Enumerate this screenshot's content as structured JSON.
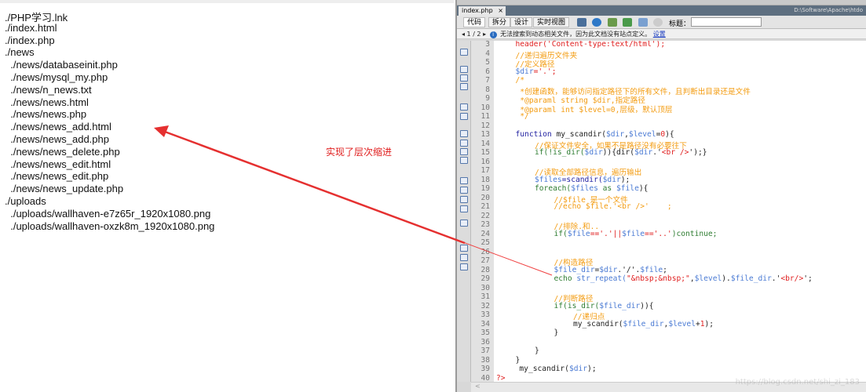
{
  "file_list": [
    "./PHP学习.lnk",
    "./index.html",
    "./index.php",
    "./news",
    "  ./news/databaseinit.php",
    "  ./news/mysql_my.php",
    "  ./news/n_news.txt",
    "  ./news/news.html",
    "  ./news/news.php",
    "  ./news/news_add.html",
    "  ./news/news_add.php",
    "  ./news/news_delete.php",
    "  ./news/news_edit.html",
    "  ./news/news_edit.php",
    "  ./news/news_update.php",
    "./uploads",
    "  ./uploads/wallhaven-e7z65r_1920x1080.png",
    "  ./uploads/wallhaven-oxzk8m_1920x1080.png"
  ],
  "annotation": "实现了层次缩进",
  "annotation_color": "#e02020",
  "ide": {
    "tab": "index.php",
    "tab_close": "×",
    "path": "D:\\Software\\Apache\\htdo",
    "view_buttons": [
      "代码",
      "拆分",
      "设计",
      "实时视图"
    ],
    "title_label": "标题：",
    "title_value": "",
    "info": {
      "nav": "◂ 1 / 2 ▸",
      "icon": "i",
      "text": "无法搜索到动态相关文件，因为此文档没有站点定义。",
      "link": "设置"
    },
    "scroll_left": "<",
    "watermark": "https://blog.csdn.net/shi_zi_183",
    "colors": {
      "c": "#f39c12",
      "v": "#4b7bd4",
      "k": "#1f1fa0",
      "g": "#2f7d32",
      "d": "#222",
      "r": "#e02020",
      "s": "#4b7bd4"
    },
    "lines": [
      {
        "n": 3,
        "i": 1,
        "t": [
          [
            "header('Content-type:text/html');",
            "r"
          ]
        ]
      },
      {
        "n": 4,
        "i": 1,
        "t": [
          [
            "//递归遍历文件夹",
            "c"
          ]
        ]
      },
      {
        "n": 5,
        "i": 1,
        "t": [
          [
            "//定义路径",
            "c"
          ]
        ]
      },
      {
        "n": 6,
        "i": 1,
        "t": [
          [
            "$dir",
            "v"
          ],
          [
            "='.';",
            "r"
          ]
        ]
      },
      {
        "n": 7,
        "i": 1,
        "t": [
          [
            "/*",
            "c"
          ]
        ]
      },
      {
        "n": 8,
        "i": 1,
        "t": [
          [
            " *创建函数，能够访问指定路径下的所有文件，且判断出目录还是文件",
            "c"
          ]
        ]
      },
      {
        "n": 9,
        "i": 1,
        "t": [
          [
            " *@paraml string $dir,指定路径",
            "c"
          ]
        ]
      },
      {
        "n": 10,
        "i": 1,
        "t": [
          [
            " *@paraml int $level=0,层级，默认顶层",
            "c"
          ]
        ]
      },
      {
        "n": 11,
        "i": 1,
        "t": [
          [
            " */",
            "c"
          ]
        ]
      },
      {
        "n": 12,
        "i": 1,
        "t": []
      },
      {
        "n": 13,
        "i": 1,
        "t": [
          [
            "function ",
            "k"
          ],
          [
            "my_scandir(",
            "d"
          ],
          [
            "$dir",
            "v"
          ],
          [
            ",",
            "d"
          ],
          [
            "$level",
            "v"
          ],
          [
            "=",
            "d"
          ],
          [
            "0",
            "r"
          ],
          [
            "){",
            "d"
          ]
        ]
      },
      {
        "n": 14,
        "i": 2,
        "t": [
          [
            "//保证文件安全，如果不是路径没有必要往下",
            "c"
          ]
        ]
      },
      {
        "n": 15,
        "i": 2,
        "t": [
          [
            "if(!is_dir(",
            "g"
          ],
          [
            "$dir",
            "v"
          ],
          [
            ")){dir(",
            "d"
          ],
          [
            "$dir",
            "v"
          ],
          [
            ".'",
            "d"
          ],
          [
            "<br />",
            "r"
          ],
          [
            "');}",
            "d"
          ]
        ]
      },
      {
        "n": 16,
        "i": 2,
        "t": []
      },
      {
        "n": 17,
        "i": 2,
        "t": [
          [
            "//读取全部路径信息，遍历输出",
            "c"
          ]
        ]
      },
      {
        "n": 18,
        "i": 2,
        "t": [
          [
            "$files",
            "v"
          ],
          [
            "=scandir(",
            "k"
          ],
          [
            "$dir",
            "v"
          ],
          [
            ");",
            "d"
          ]
        ]
      },
      {
        "n": 19,
        "i": 2,
        "t": [
          [
            "foreach(",
            "g"
          ],
          [
            "$files",
            "v"
          ],
          [
            " as ",
            "g"
          ],
          [
            "$file",
            "v"
          ],
          [
            "){",
            "d"
          ]
        ]
      },
      {
        "n": 20,
        "i": 3,
        "t": [
          [
            "//$file 是一个文件",
            "c"
          ]
        ]
      },
      {
        "n": 21,
        "i": 3,
        "t": [
          [
            "//echo $file.'<br />'    ;",
            "c"
          ]
        ]
      },
      {
        "n": 22,
        "i": 3,
        "t": []
      },
      {
        "n": 23,
        "i": 3,
        "t": [
          [
            "//排除.和..",
            "c"
          ]
        ]
      },
      {
        "n": 24,
        "i": 3,
        "t": [
          [
            "if(",
            "g"
          ],
          [
            "$file",
            "v"
          ],
          [
            "=='.'||",
            "r"
          ],
          [
            "$file",
            "v"
          ],
          [
            "=='..'",
            "r"
          ],
          [
            ")continue;",
            "g"
          ]
        ]
      },
      {
        "n": 25,
        "i": 3,
        "t": []
      },
      {
        "n": 26,
        "i": 3,
        "t": []
      },
      {
        "n": 27,
        "i": 3,
        "t": [
          [
            "//构造路径",
            "c"
          ]
        ]
      },
      {
        "n": 28,
        "i": 3,
        "t": [
          [
            "$file_dir",
            "v"
          ],
          [
            "=",
            "d"
          ],
          [
            "$dir",
            "v"
          ],
          [
            ".'/'.",
            "d"
          ],
          [
            "$file",
            "v"
          ],
          [
            ";",
            "d"
          ]
        ]
      },
      {
        "n": 29,
        "i": 3,
        "t": [
          [
            "echo ",
            "g"
          ],
          [
            "str_repeat(",
            "v"
          ],
          [
            "\"&nbsp;&nbsp;\"",
            "r"
          ],
          [
            ",",
            "d"
          ],
          [
            "$level",
            "v"
          ],
          [
            ").",
            "d"
          ],
          [
            "$file_dir",
            "v"
          ],
          [
            ".'",
            "d"
          ],
          [
            "<br/>",
            "r"
          ],
          [
            "';",
            "d"
          ]
        ]
      },
      {
        "n": 30,
        "i": 3,
        "t": []
      },
      {
        "n": 31,
        "i": 3,
        "t": [
          [
            "//判断路径",
            "c"
          ]
        ]
      },
      {
        "n": 32,
        "i": 3,
        "t": [
          [
            "if(is_dir(",
            "g"
          ],
          [
            "$file_dir",
            "v"
          ],
          [
            ")){",
            "d"
          ]
        ]
      },
      {
        "n": 33,
        "i": 4,
        "t": [
          [
            "//递归点",
            "c"
          ]
        ]
      },
      {
        "n": 34,
        "i": 4,
        "t": [
          [
            "my_scandir(",
            "d"
          ],
          [
            "$file_dir",
            "v"
          ],
          [
            ",",
            "d"
          ],
          [
            "$level",
            "v"
          ],
          [
            "+",
            "d"
          ],
          [
            "1",
            "r"
          ],
          [
            ");",
            "d"
          ]
        ]
      },
      {
        "n": 35,
        "i": 3,
        "t": [
          [
            "}",
            "d"
          ]
        ]
      },
      {
        "n": 36,
        "i": 3,
        "t": []
      },
      {
        "n": 37,
        "i": 2,
        "t": [
          [
            "}",
            "d"
          ]
        ]
      },
      {
        "n": 38,
        "i": 1,
        "t": [
          [
            "}",
            "d"
          ]
        ]
      },
      {
        "n": 39,
        "i": 1.2,
        "t": [
          [
            "my_scandir(",
            "d"
          ],
          [
            "$dir",
            "v"
          ],
          [
            ");",
            "d"
          ]
        ]
      },
      {
        "n": 40,
        "i": 0,
        "t": [
          [
            "?>",
            "r"
          ]
        ]
      }
    ]
  }
}
